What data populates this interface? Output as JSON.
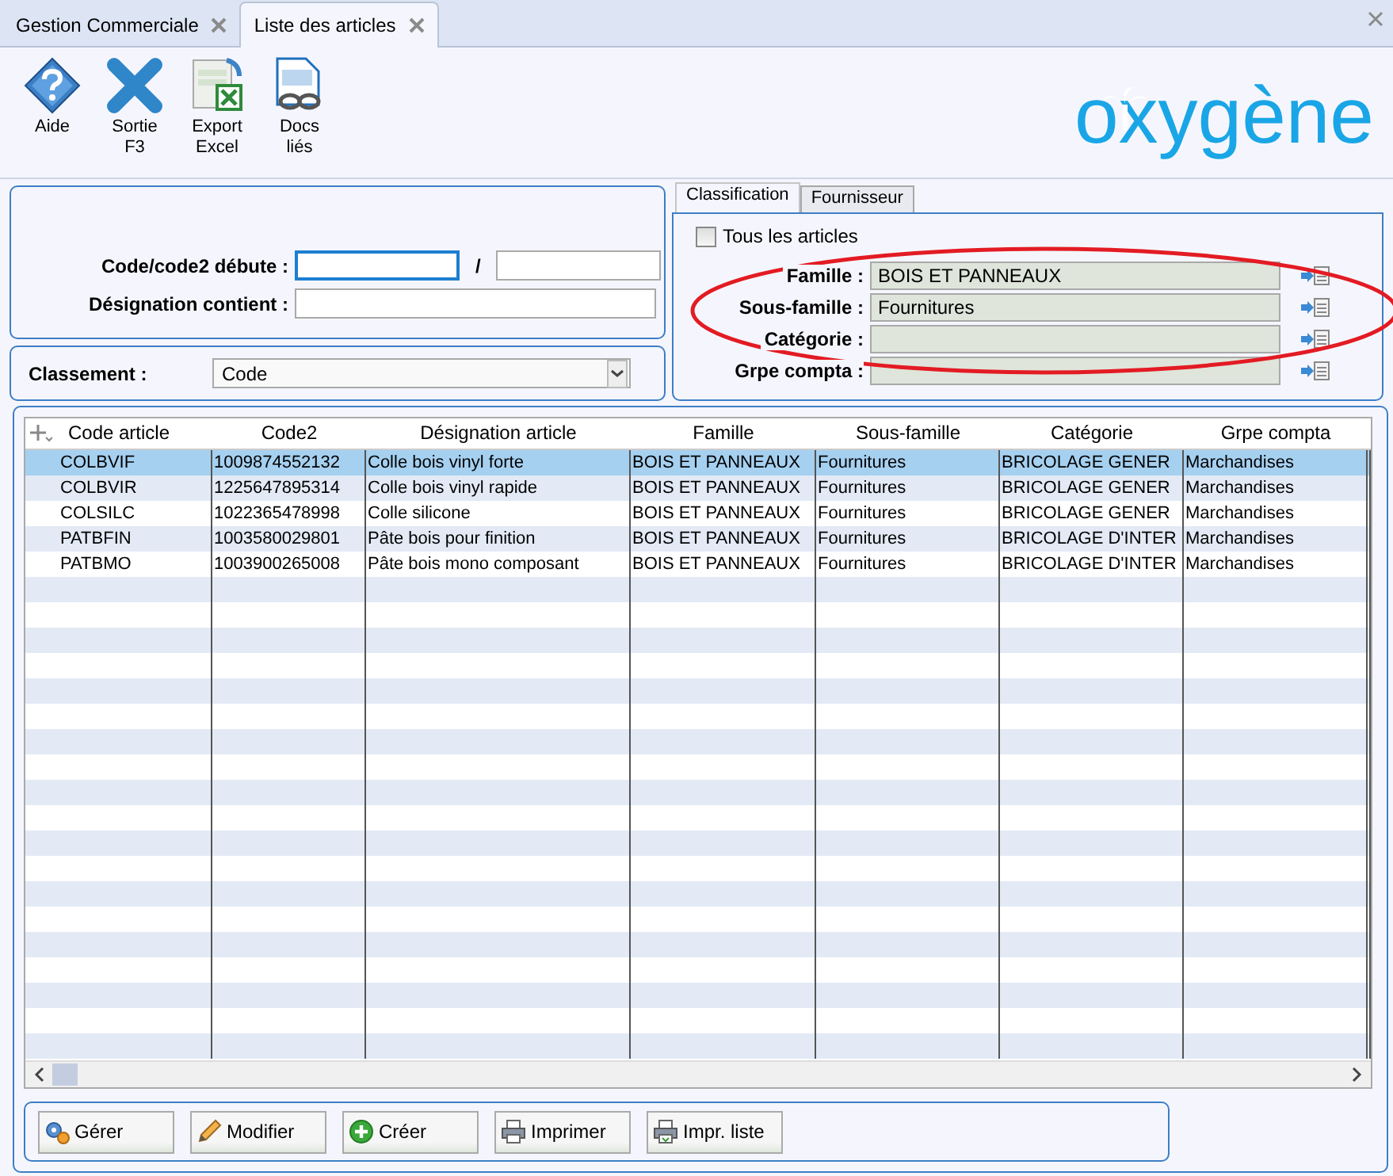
{
  "tabs": [
    {
      "label": "Gestion Commerciale",
      "selected": false
    },
    {
      "label": "Liste des articles",
      "selected": true
    }
  ],
  "toolbar": [
    {
      "kind": "help",
      "label": "Aide"
    },
    {
      "kind": "exit",
      "label": "Sortie\nF3"
    },
    {
      "kind": "excel",
      "label": "Export\nExcel"
    },
    {
      "kind": "docs",
      "label": "Docs\nliés"
    }
  ],
  "logo": "oxygène",
  "search": {
    "code_label": "Code/code2 débute :",
    "separator": "/",
    "designation_label": "Désignation contient :"
  },
  "sort": {
    "label": "Classement :",
    "value": "Code"
  },
  "filter_tabs": [
    {
      "label": "Classification",
      "selected": true
    },
    {
      "label": "Fournisseur",
      "selected": false
    }
  ],
  "all_articles": {
    "label": "Tous les articles",
    "checked": false
  },
  "filters": [
    {
      "label": "Famille :",
      "value": "BOIS ET PANNEAUX"
    },
    {
      "label": "Sous-famille :",
      "value": "Fournitures"
    },
    {
      "label": "Catégorie :"
    },
    {
      "label": "Grpe compta :"
    }
  ],
  "table": {
    "columns": [
      "Code article",
      "Code2",
      "Désignation article",
      "Famille",
      "Sous-famille",
      "Catégorie",
      "Grpe compta"
    ],
    "rows": [
      {
        "selected": true,
        "cells": [
          "COLBVIF",
          "1009874552132",
          "Colle bois vinyl forte",
          "BOIS ET PANNEAUX",
          "Fournitures",
          "BRICOLAGE GENER",
          "Marchandises"
        ]
      },
      {
        "selected": false,
        "cells": [
          "COLBVIR",
          "1225647895314",
          "Colle bois vinyl rapide",
          "BOIS ET PANNEAUX",
          "Fournitures",
          "BRICOLAGE GENER",
          "Marchandises"
        ]
      },
      {
        "selected": false,
        "cells": [
          "COLSILC",
          "1022365478998",
          "Colle silicone",
          "BOIS ET PANNEAUX",
          "Fournitures",
          "BRICOLAGE GENER",
          "Marchandises"
        ]
      },
      {
        "selected": false,
        "cells": [
          "PATBFIN",
          "1003580029801",
          "Pâte bois pour finition",
          "BOIS ET PANNEAUX",
          "Fournitures",
          "BRICOLAGE D'INTER",
          "Marchandises"
        ]
      },
      {
        "selected": false,
        "cells": [
          "PATBMO",
          "1003900265008",
          "Pâte bois mono composant",
          "BOIS ET PANNEAUX",
          "Fournitures",
          "BRICOLAGE D'INTER",
          "Marchandises"
        ]
      }
    ]
  },
  "buttons": [
    {
      "kind": "manage",
      "label": "Gérer"
    },
    {
      "kind": "edit",
      "label": "Modifier"
    },
    {
      "kind": "create",
      "label": "Créer"
    },
    {
      "kind": "print",
      "label": "Imprimer"
    },
    {
      "kind": "printlist",
      "label": "Impr. liste"
    }
  ]
}
